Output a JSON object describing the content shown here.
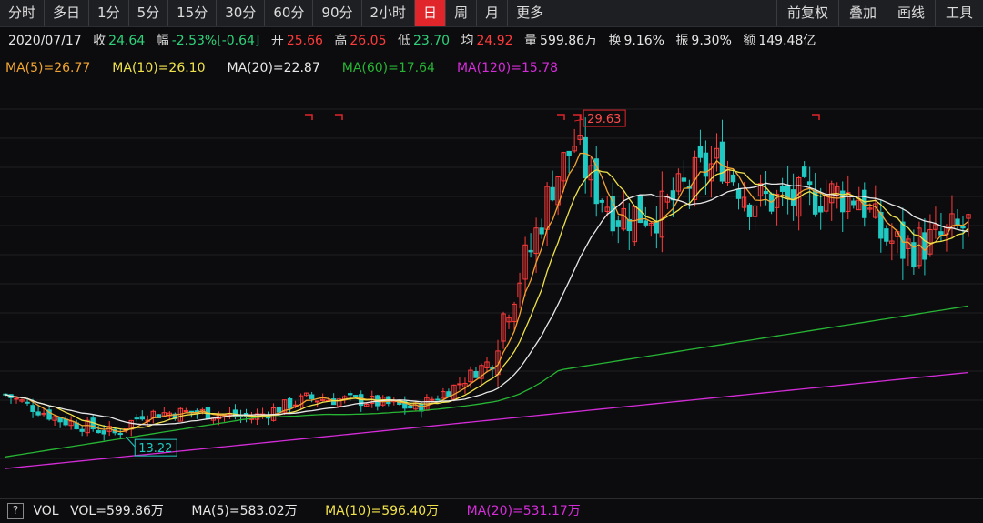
{
  "toolbar": {
    "periods": [
      "分时",
      "多日",
      "1分",
      "5分",
      "15分",
      "30分",
      "60分",
      "90分",
      "2小时",
      "日",
      "周",
      "月",
      "更多"
    ],
    "active": "日",
    "tools": [
      "前复权",
      "叠加",
      "画线",
      "工具"
    ]
  },
  "info": {
    "date": "2020/07/17",
    "close_label": "收",
    "close": "24.64",
    "change_label": "幅",
    "change": "-2.53%[-0.64]",
    "open_label": "开",
    "open": "25.66",
    "high_label": "高",
    "high": "26.05",
    "low_label": "低",
    "low": "23.70",
    "avg_label": "均",
    "avg": "24.92",
    "volume_label": "量",
    "volume": "599.86万",
    "turnover_label": "换",
    "turnover": "9.16%",
    "amplitude_label": "振",
    "amplitude": "9.30%",
    "amount_label": "额",
    "amount": "149.48亿"
  },
  "ma_legend": [
    {
      "text": "MA(5)=26.77",
      "color": "#f2a531"
    },
    {
      "text": "MA(10)=26.10",
      "color": "#f0e24a"
    },
    {
      "text": "MA(20)=22.87",
      "color": "#e8e8e8"
    },
    {
      "text": "MA(60)=17.64",
      "color": "#27b534"
    },
    {
      "text": "MA(120)=15.78",
      "color": "#d52cd9"
    }
  ],
  "chart_annotations": {
    "max_price": "29.63",
    "min_price": "13.22"
  },
  "volume_bar": {
    "help": "?",
    "label": "VOL",
    "vol": "VOL=599.86万",
    "ma5": "MA(5)=583.02万",
    "ma10": "MA(10)=596.40万",
    "ma20": "MA(20)=531.17万",
    "colors": {
      "vol": "#e6e6e6",
      "ma5": "#e6e6e6",
      "ma10": "#f0e24a",
      "ma20": "#d52cd9"
    }
  },
  "colors": {
    "up": "#ff3b3b",
    "down": "#20c9c2",
    "active_tab": "#e0252b"
  }
}
